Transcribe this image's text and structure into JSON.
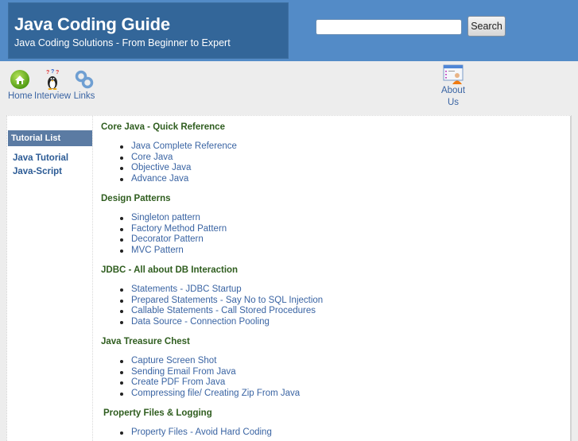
{
  "header": {
    "title": "Java Coding Guide",
    "tagline": "Java Coding Solutions - From Beginner to Expert",
    "search": {
      "placeholder": "",
      "value": "",
      "button_label": "Search"
    }
  },
  "nav": {
    "items": [
      {
        "label": "Home",
        "icon": "home-icon"
      },
      {
        "label": "Interview",
        "icon": "penguin-icon"
      },
      {
        "label": "Links",
        "icon": "chain-link-icon"
      },
      {
        "label": "About Us",
        "label_line1": "About",
        "label_line2": "Us",
        "icon": "about-user-icon"
      }
    ]
  },
  "sidebar": {
    "heading": "Tutorial List",
    "links": [
      "Java Tutorial",
      "Java-Script"
    ]
  },
  "sections": [
    {
      "title": "Core Java - Quick Reference",
      "items": [
        "Java Complete Reference",
        "Core Java",
        "Objective Java",
        "Advance Java"
      ]
    },
    {
      "title": "Design Patterns",
      "items": [
        "Singleton pattern",
        "Factory Method Pattern",
        "Decorator Pattern",
        "MVC Pattern"
      ]
    },
    {
      "title": "JDBC - All about DB Interaction",
      "items": [
        "Statements - JDBC Startup",
        "Prepared Statements - Say No to SQL Injection",
        "Callable Statements - Call Stored Procedures",
        "Data Source - Connection Pooling"
      ]
    },
    {
      "title": "Java Treasure Chest",
      "items": [
        "Capture Screen Shot",
        "Sending Email From Java",
        "Create PDF From Java",
        "Compressing file/ Creating Zip From Java"
      ]
    },
    {
      "title": "Property Files & Logging",
      "items": [
        "Property Files - Avoid Hard Coding"
      ]
    }
  ],
  "colors": {
    "header_bg": "#538bc7",
    "brand_bg": "#336699",
    "link": "#3a64a3",
    "section_title": "#2f5d1f",
    "sidebar_heading_bg": "#5b7ba3"
  }
}
